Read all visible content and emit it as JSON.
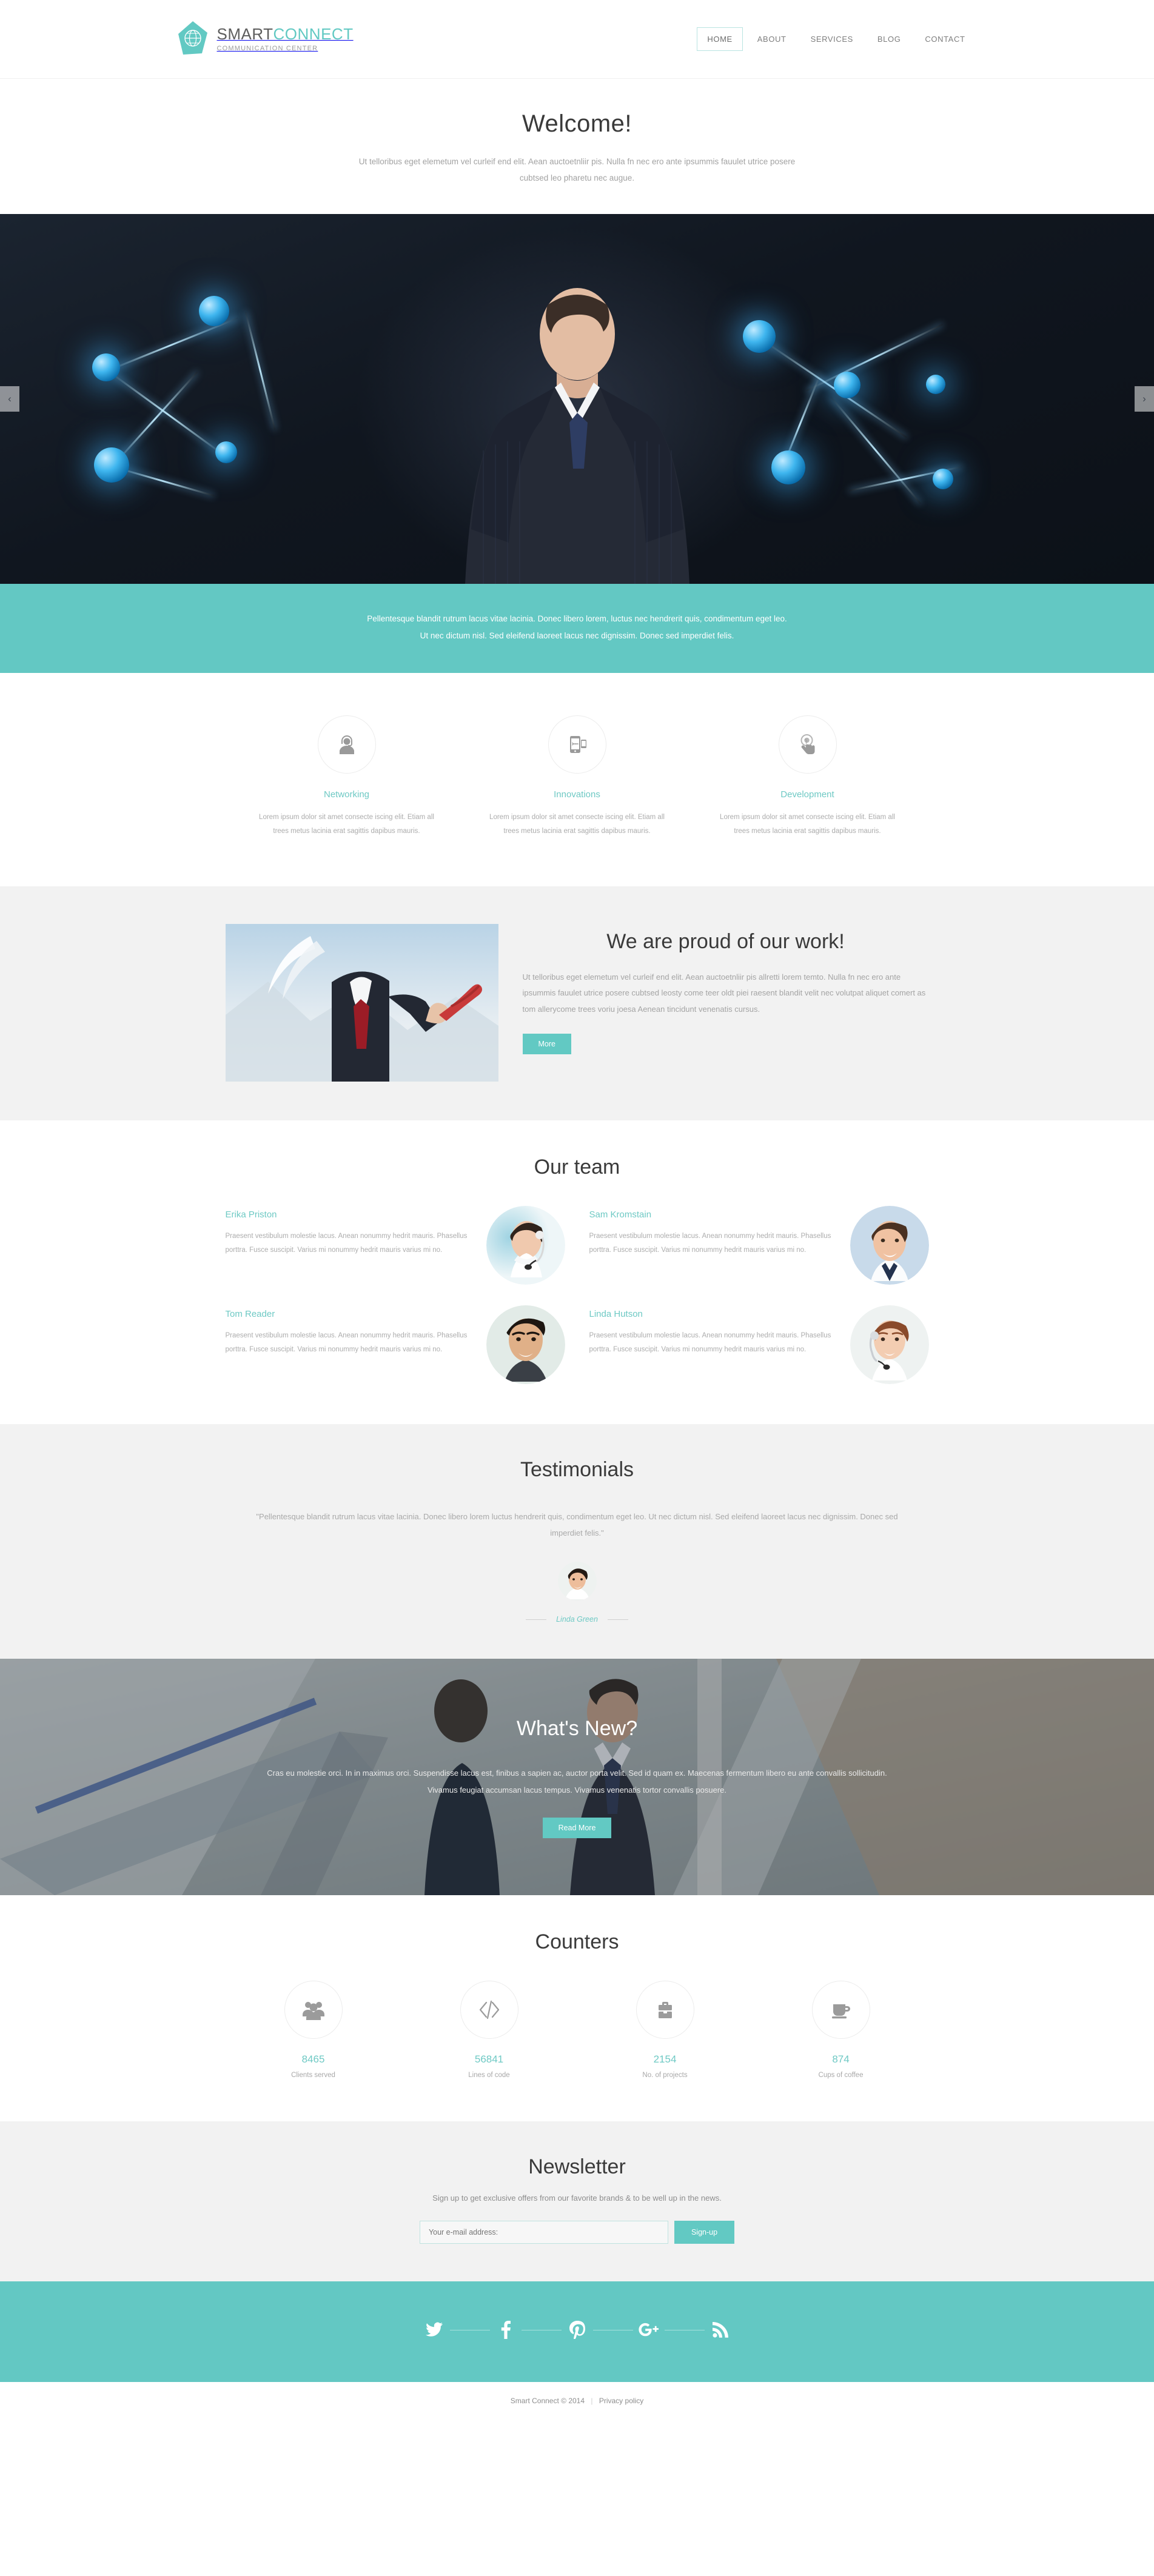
{
  "header": {
    "brand": {
      "name_part1": "SMART",
      "name_part2": "CONNECT",
      "tagline": "COMMUNICATION CENTER"
    },
    "nav": [
      {
        "label": "HOME",
        "active": true
      },
      {
        "label": "ABOUT",
        "active": false
      },
      {
        "label": "SERVICES",
        "active": false
      },
      {
        "label": "BLOG",
        "active": false
      },
      {
        "label": "CONTACT",
        "active": false
      }
    ]
  },
  "welcome": {
    "title": "Welcome!",
    "text": "Ut telloribus eget elemetum vel curleif end elit. Aean auctoetnliir pis. Nulla fn nec ero ante ipsummis fauulet utrice posere cubtsed leo pharetu nec augue."
  },
  "hero": {
    "prev_label": "‹",
    "next_label": "›"
  },
  "caption": {
    "line1": "Pellentesque blandit rutrum lacus vitae lacinia. Donec libero lorem, luctus nec hendrerit quis, condimentum eget leo.",
    "line2": "Ut nec dictum nisl. Sed eleifend laoreet lacus nec dignissim. Donec sed imperdiet felis."
  },
  "services": [
    {
      "icon": "headset-support-icon",
      "title": "Networking",
      "desc": "Lorem ipsum dolor sit amet consecte iscing elit. Etiam all trees metus lacinia erat sagittis dapibus mauris."
    },
    {
      "icon": "mobile-sync-icon",
      "title": "Innovations",
      "desc": "Lorem ipsum dolor sit amet consecte iscing elit. Etiam all trees metus lacinia erat sagittis dapibus mauris."
    },
    {
      "icon": "touch-hand-icon",
      "title": "Development",
      "desc": "Lorem ipsum dolor sit amet consecte iscing elit. Etiam all trees metus lacinia erat sagittis dapibus mauris."
    }
  ],
  "proud": {
    "title": "We are proud of our work!",
    "text": "Ut telloribus eget elemetum vel curleif end elit. Aean auctoetnliir pis allretti lorem temto. Nulla fn nec ero ante ipsummis fauulet utrice posere cubtsed leosty come teer oldt piei raesent blandit velit nec volutpat aliquet comert as tom allerycome trees voriu joesa Aenean tincidunt venenatis cursus.",
    "button": "More"
  },
  "team": {
    "title": "Our team",
    "members": [
      {
        "name": "Erika Priston",
        "desc": "Praesent vestibulum molestie lacus. Anean nonummy hedrit mauris. Phasellus porttra. Fusce suscipit. Varius mi nonummy hedrit mauris varius mi no.",
        "avatar": "female-headset-operator"
      },
      {
        "name": "Sam Kromstain",
        "desc": "Praesent vestibulum molestie lacus. Anean nonummy hedrit mauris. Phasellus porttra. Fusce suscipit. Varius mi nonummy hedrit mauris varius mi no.",
        "avatar": "male-businessman-smiling"
      },
      {
        "name": "Tom Reader",
        "desc": "Praesent vestibulum molestie lacus. Anean nonummy hedrit mauris. Phasellus porttra. Fusce suscipit. Varius mi nonummy hedrit mauris varius mi no.",
        "avatar": "male-dark-hair"
      },
      {
        "name": "Linda Hutson",
        "desc": "Praesent vestibulum molestie lacus. Anean nonummy hedrit mauris. Phasellus porttra. Fusce suscipit. Varius mi nonummy hedrit mauris varius mi no.",
        "avatar": "female-headset-redhead"
      }
    ]
  },
  "testimonials": {
    "title": "Testimonials",
    "quote": "\"Pellentesque blandit rutrum lacus vitae lacinia. Donec libero lorem luctus hendrerit quis, condimentum eget leo. Ut nec dictum nisl. Sed eleifend laoreet lacus nec dignissim. Donec sed imperdiet felis.\"",
    "author": "Linda Green"
  },
  "whatsnew": {
    "title": "What's New?",
    "text": "Cras eu molestie orci. In in maximus orci. Suspendisse lacus est, finibus a sapien ac, auctor porta velit. Sed id quam ex. Maecenas fermentum libero eu ante convallis sollicitudin. Vivamus feugiat accumsan lacus tempus. Vivamus venenatis tortor convallis posuere.",
    "button": "Read More"
  },
  "counters": {
    "title": "Counters",
    "items": [
      {
        "icon": "users-group-icon",
        "value": "8465",
        "label": "Clients served"
      },
      {
        "icon": "code-brackets-icon",
        "value": "56841",
        "label": "Lines of code"
      },
      {
        "icon": "briefcase-icon",
        "value": "2154",
        "label": "No. of projects"
      },
      {
        "icon": "coffee-cup-icon",
        "value": "874",
        "label": "Cups of coffee"
      }
    ]
  },
  "newsletter": {
    "title": "Newsletter",
    "subtitle": "Sign up to get exclusive offers from our favorite brands & to be well up in the news.",
    "input_placeholder": "Your e-mail address:",
    "input_value": "",
    "button": "Sign-up"
  },
  "social": [
    {
      "name": "twitter-icon",
      "label": "Twitter"
    },
    {
      "name": "facebook-icon",
      "label": "Facebook"
    },
    {
      "name": "pinterest-icon",
      "label": "Pinterest"
    },
    {
      "name": "google-plus-icon",
      "label": "Google Plus"
    },
    {
      "name": "rss-icon",
      "label": "RSS"
    }
  ],
  "footer": {
    "copyright": "Smart Connect © 2014",
    "divider": "|",
    "privacy": "Privacy policy"
  },
  "colors": {
    "accent": "#63c8c3",
    "accent_text": "#6ec9c4",
    "dark_text": "#3a3a3a",
    "body_text": "#a2a2a2",
    "light_bg": "#f2f2f2"
  }
}
